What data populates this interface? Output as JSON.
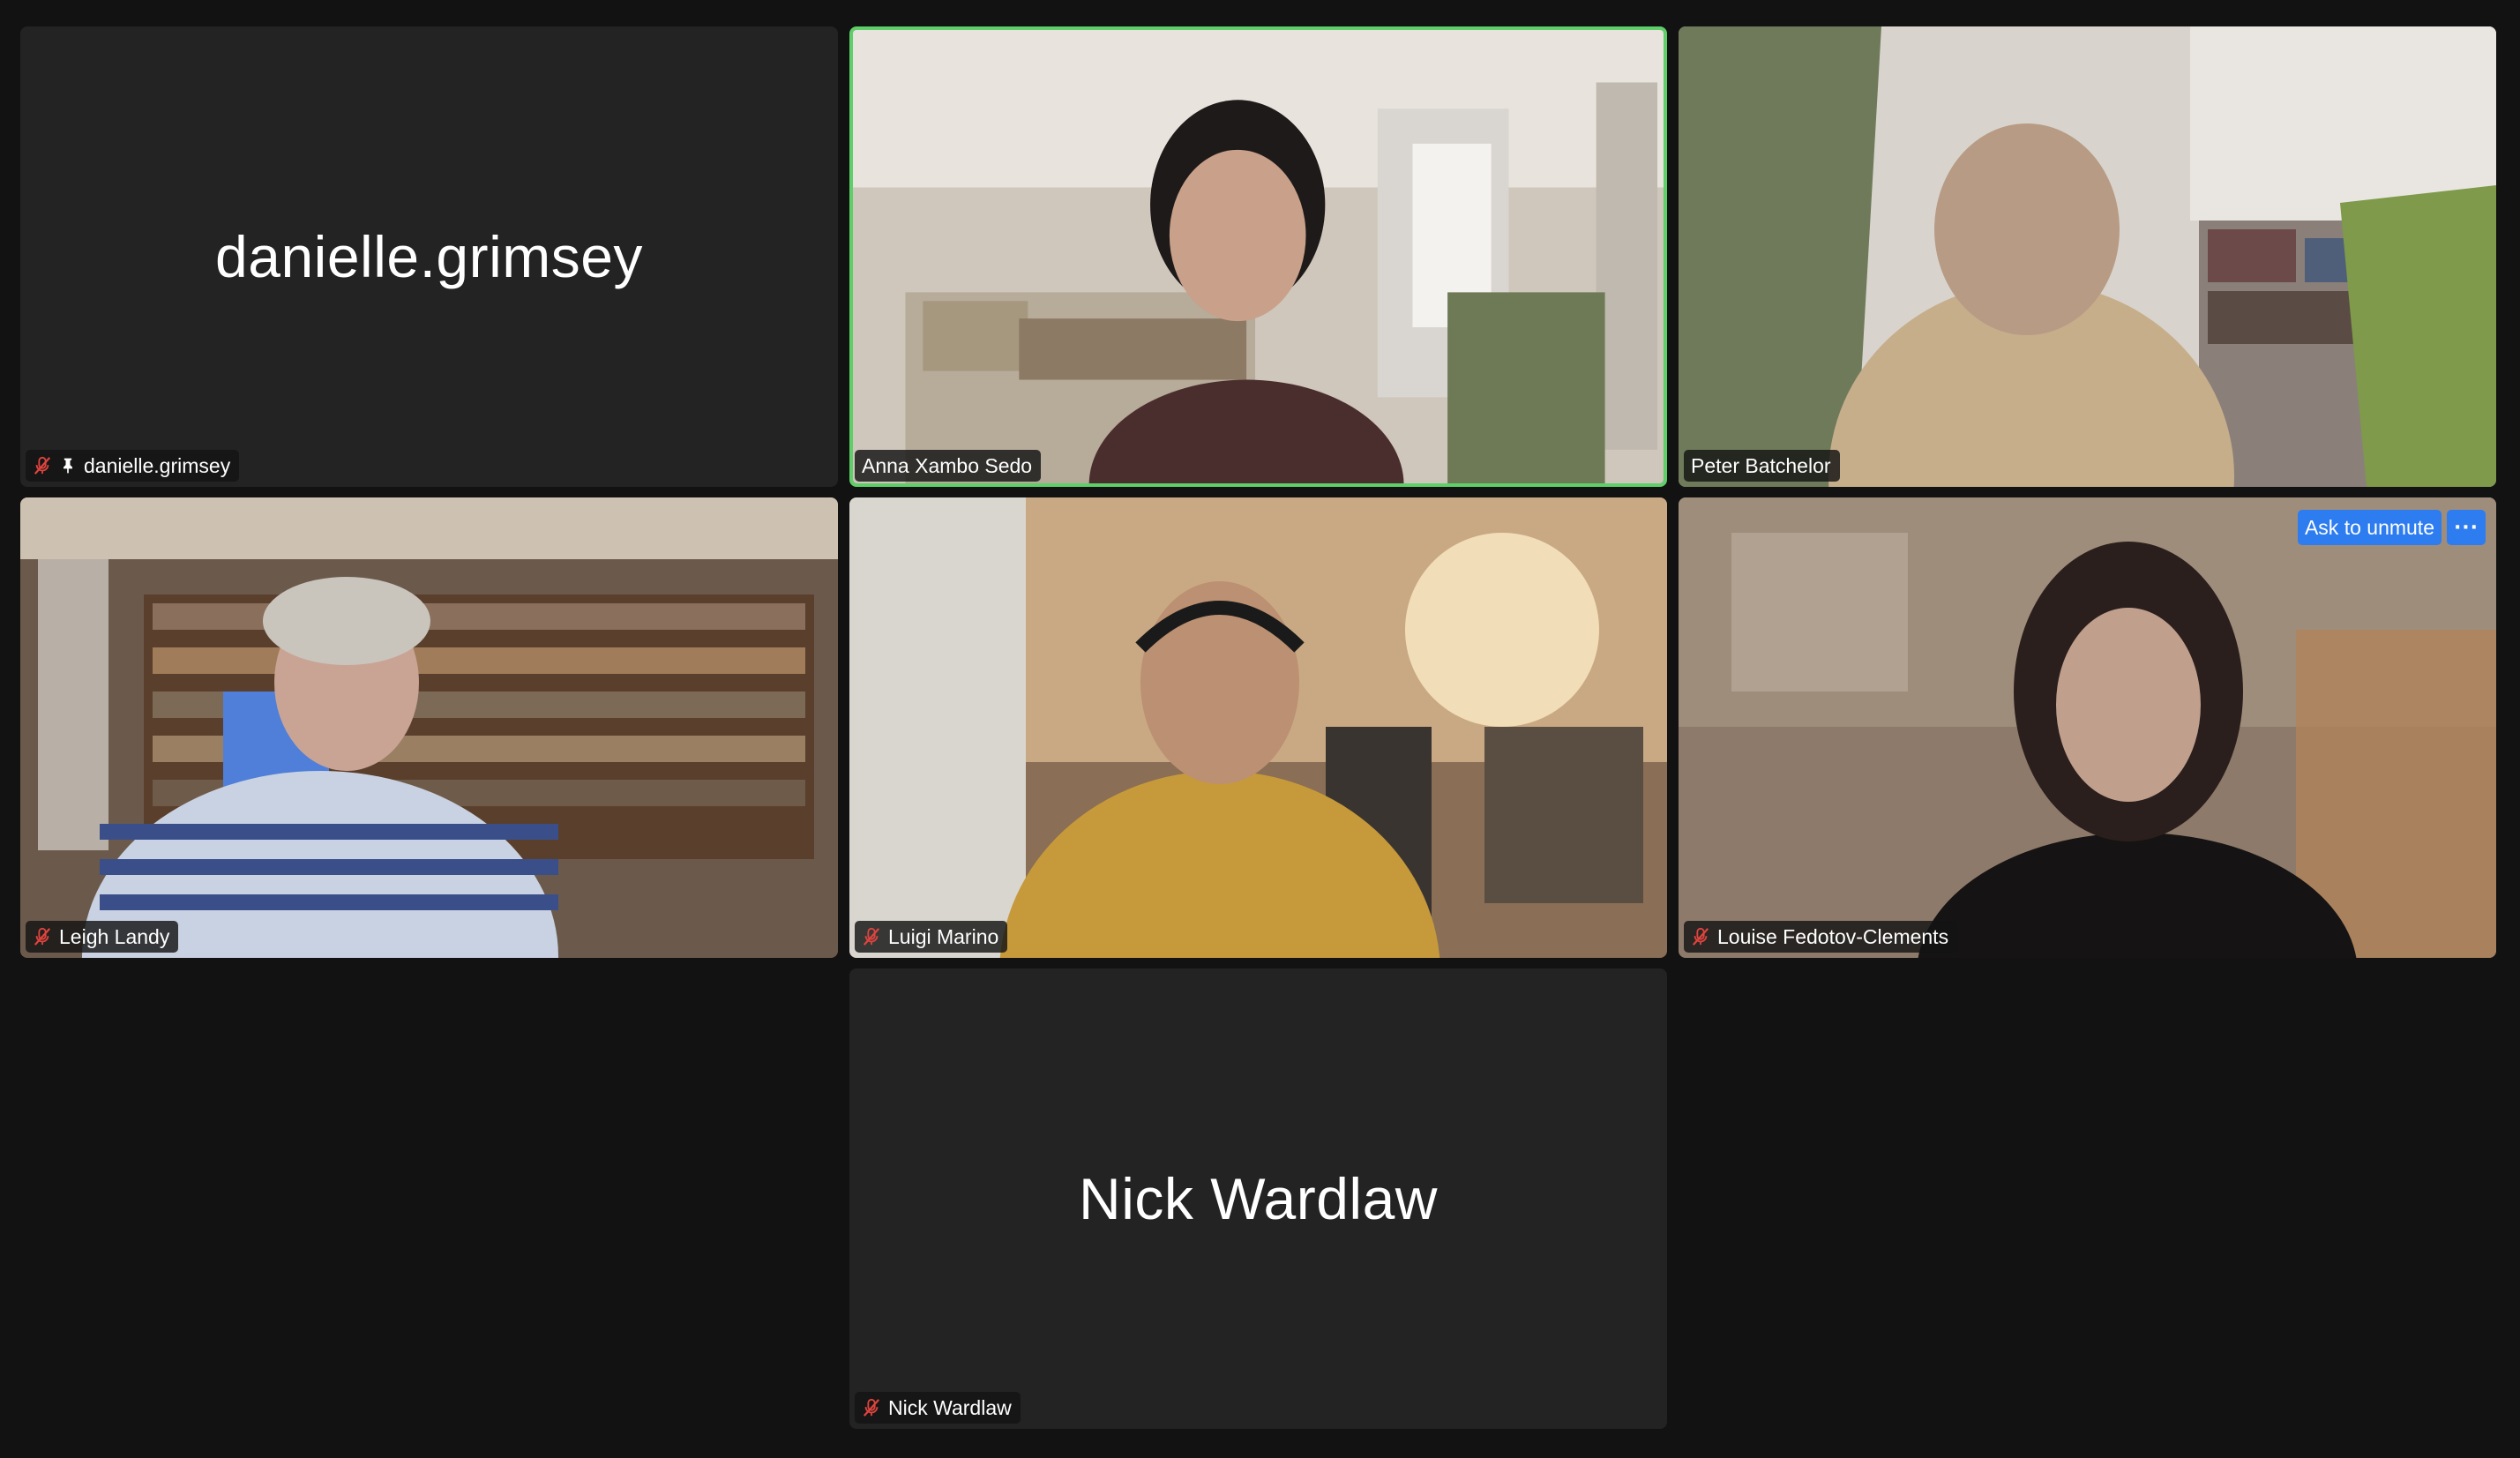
{
  "colors": {
    "background": "#121212",
    "tile": "#232323",
    "active_speaker_border": "#5fcf6a",
    "accent_blue": "#2d7cf0",
    "muted_icon": "#e0443e"
  },
  "participants": [
    {
      "id": "danielle",
      "display_name": "danielle.grimsey",
      "tag": "danielle.grimsey",
      "video": false,
      "muted": true,
      "pinned": true
    },
    {
      "id": "anna",
      "tag": "Anna Xambo Sedo",
      "video": true,
      "muted": false,
      "active_speaker": true
    },
    {
      "id": "peter",
      "tag": "Peter Batchelor",
      "video": true,
      "muted": false
    },
    {
      "id": "leigh",
      "tag": "Leigh Landy",
      "video": true,
      "muted": true
    },
    {
      "id": "luigi",
      "tag": "Luigi Marino",
      "video": true,
      "muted": true
    },
    {
      "id": "louise",
      "tag": "Louise Fedotov-Clements",
      "video": true,
      "muted": true
    },
    {
      "id": "nick",
      "display_name": "Nick Wardlaw",
      "tag": "Nick Wardlaw",
      "video": false,
      "muted": true
    }
  ],
  "controls": {
    "ask_to_unmute": "Ask to unmute",
    "more": "···"
  }
}
